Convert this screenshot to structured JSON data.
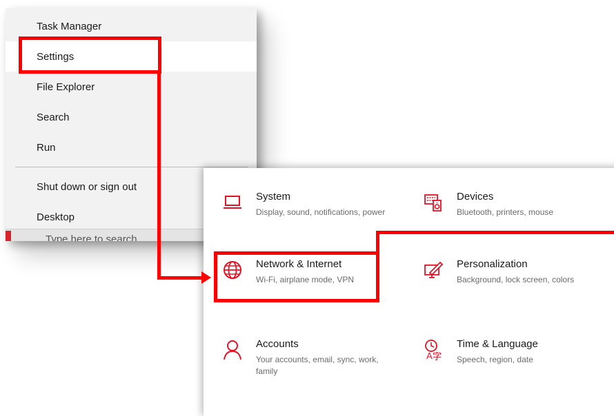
{
  "context_menu": {
    "items": [
      {
        "label": "Task Manager"
      },
      {
        "label": "Settings"
      },
      {
        "label": "File Explorer"
      },
      {
        "label": "Search"
      },
      {
        "label": "Run"
      },
      {
        "label": "Shut down or sign out"
      },
      {
        "label": "Desktop"
      }
    ],
    "hovered_item": "Settings"
  },
  "taskbar": {
    "search_placeholder_partial": "Type here to search"
  },
  "settings": {
    "tiles": [
      {
        "title": "System",
        "desc": "Display, sound, notifications, power",
        "icon": "laptop-icon"
      },
      {
        "title": "Devices",
        "desc": "Bluetooth, printers, mouse",
        "icon": "devices-icon"
      },
      {
        "title": "Network & Internet",
        "desc": "Wi-Fi, airplane mode, VPN",
        "icon": "globe-icon"
      },
      {
        "title": "Personalization",
        "desc": "Background, lock screen, colors",
        "icon": "paint-icon"
      },
      {
        "title": "Accounts",
        "desc": "Your accounts, email, sync, work, family",
        "icon": "person-icon"
      },
      {
        "title": "Time & Language",
        "desc": "Speech, region, date",
        "icon": "time-language-icon"
      }
    ]
  },
  "colors": {
    "accent_icon": "#e81123",
    "annotation": "#ff0000",
    "menu_bg": "#f2f2f2",
    "menu_hover": "#ffffff"
  }
}
